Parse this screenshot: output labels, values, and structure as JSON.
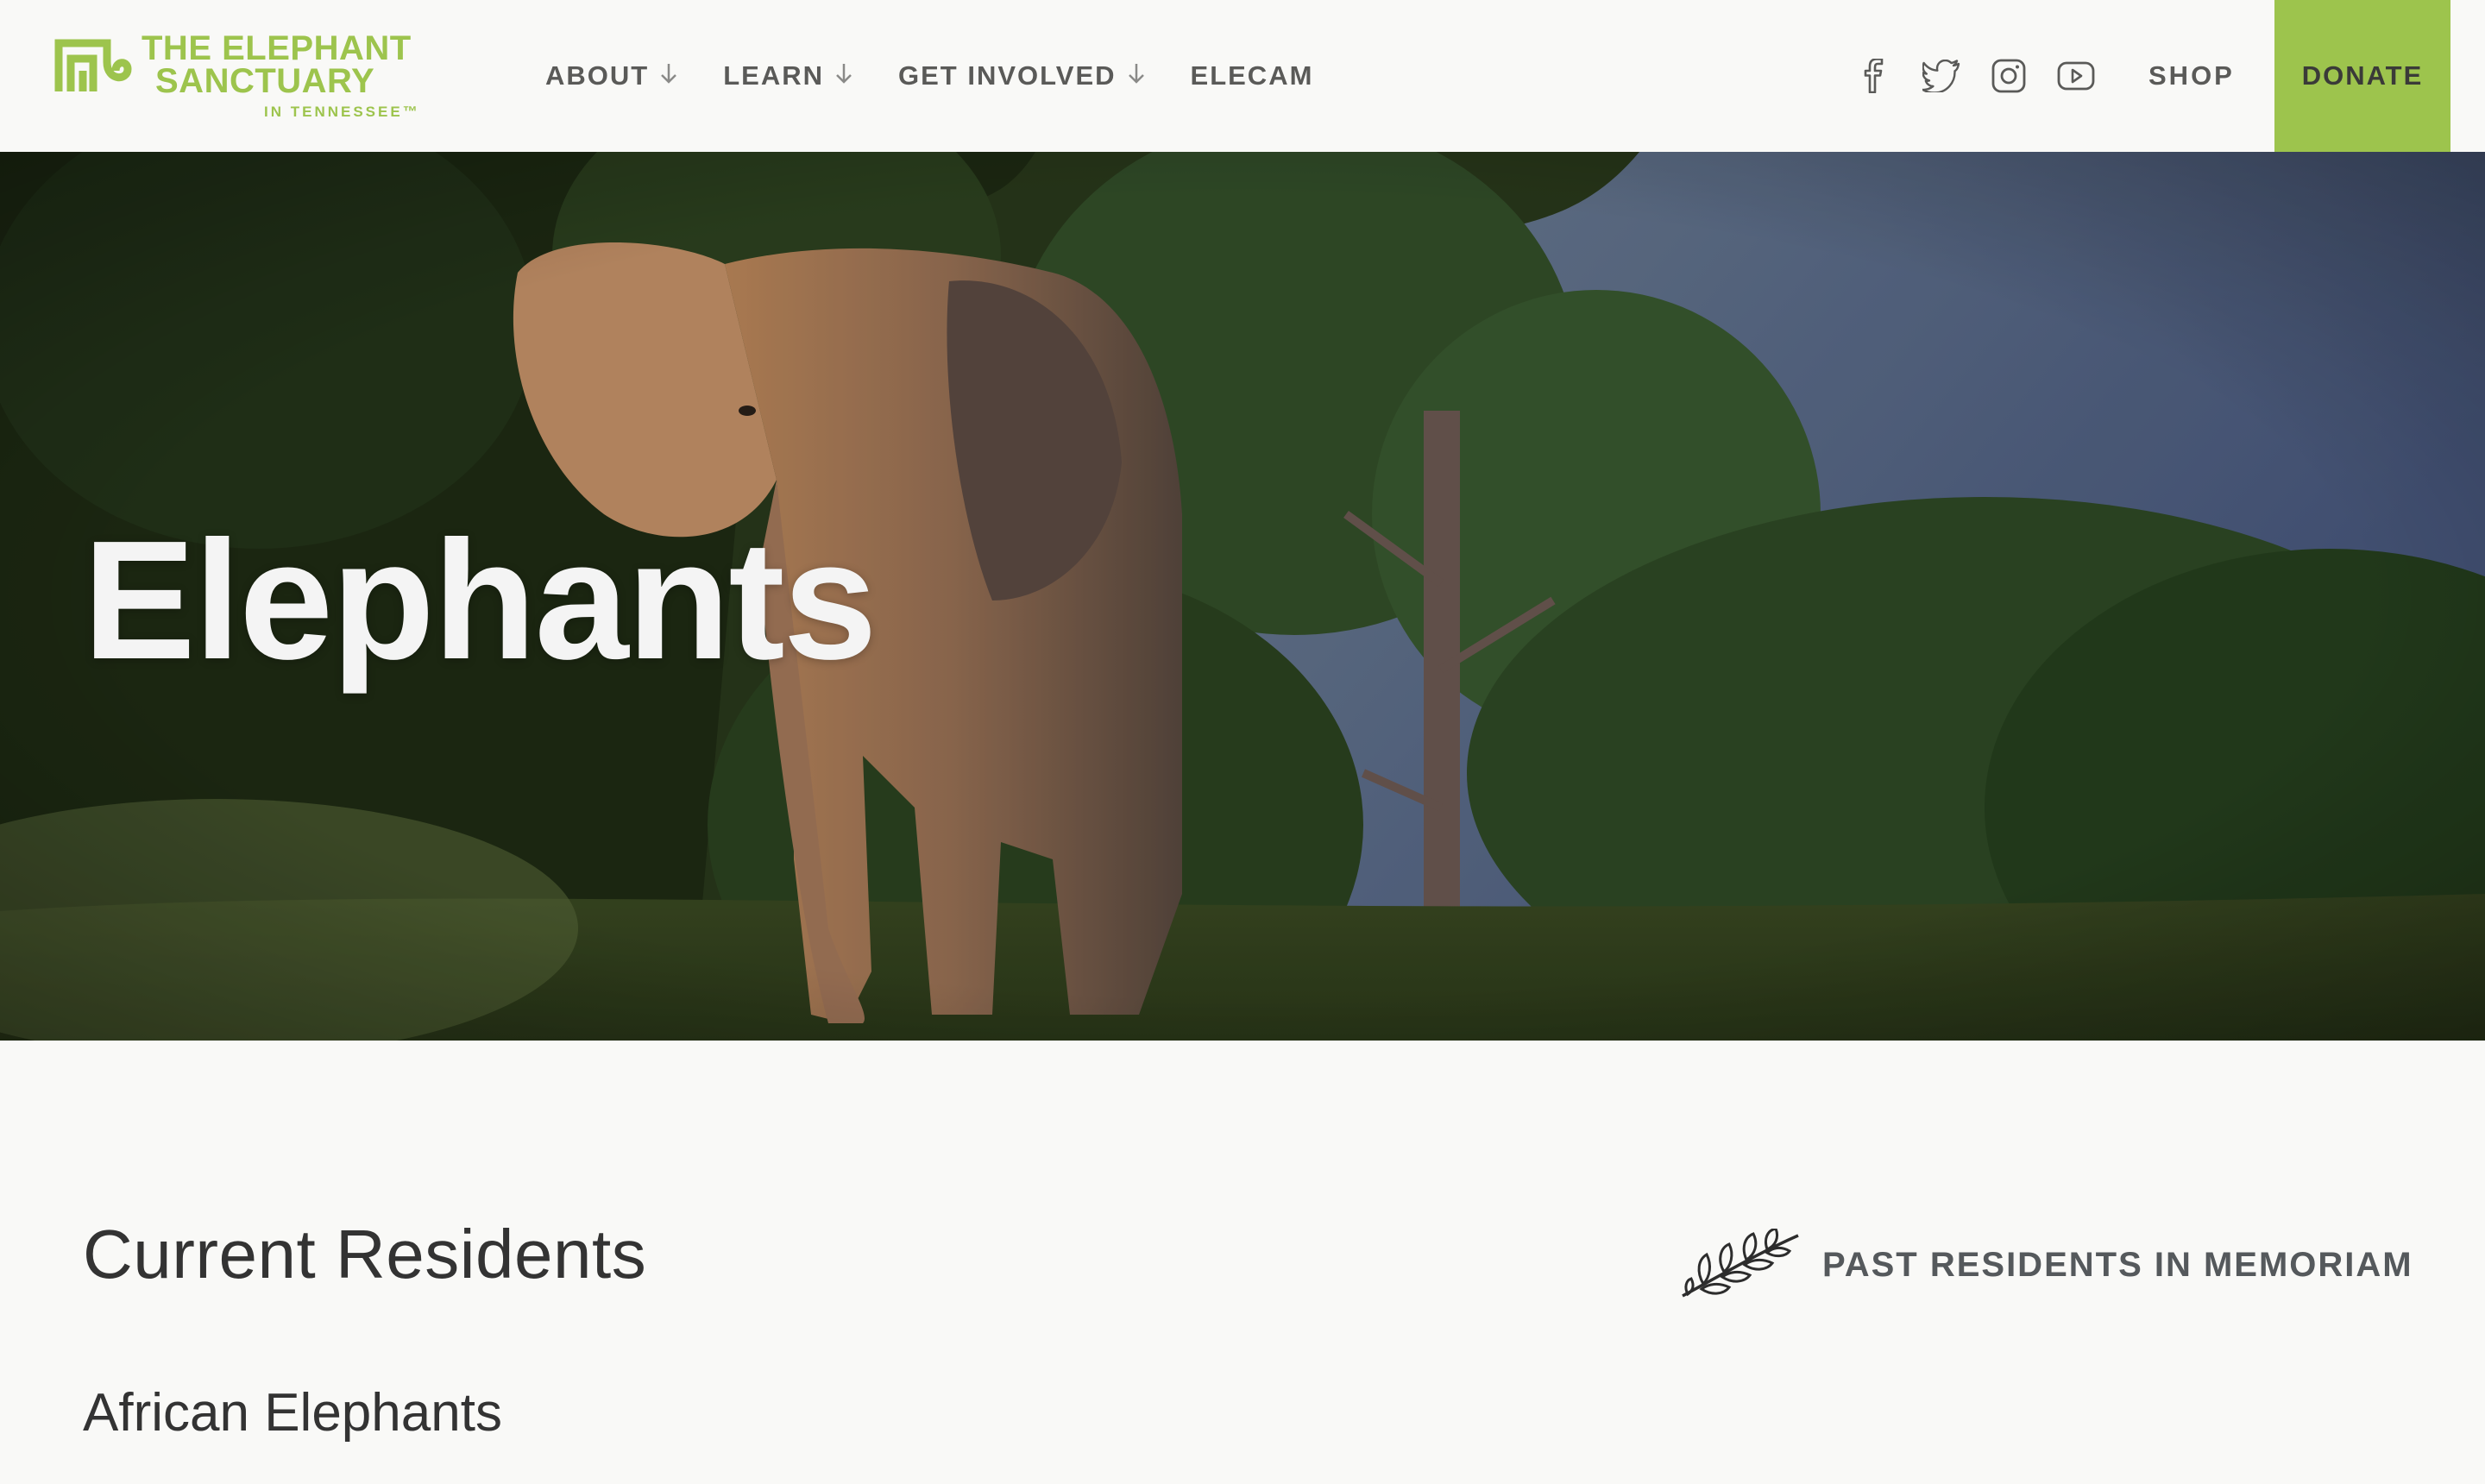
{
  "brand": {
    "line1": "THE ELEPHANT",
    "line2": "SANCTUARY",
    "line3": "IN TENNESSEE™",
    "color": "#9dc44d"
  },
  "nav": {
    "items": [
      {
        "label": "ABOUT",
        "has_dropdown": true
      },
      {
        "label": "LEARN",
        "has_dropdown": true
      },
      {
        "label": "GET INVOLVED",
        "has_dropdown": true
      },
      {
        "label": "ELECAM",
        "has_dropdown": false
      }
    ],
    "social_icons": [
      "facebook-icon",
      "twitter-icon",
      "instagram-icon",
      "youtube-icon"
    ],
    "shop_label": "SHOP",
    "donate_label": "DONATE"
  },
  "hero": {
    "title": "Elephants"
  },
  "content": {
    "section_title": "Current Residents",
    "memoriam_link": "PAST RESIDENTS IN MEMORIAM",
    "subsection_title": "African Elephants"
  },
  "colors": {
    "accent": "#9dc44d",
    "page_background": "#f9f9f7",
    "text": "#333333"
  }
}
